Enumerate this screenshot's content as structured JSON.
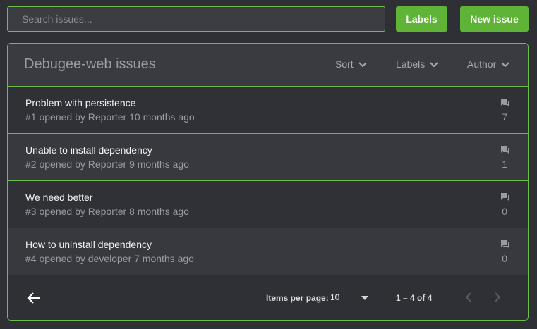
{
  "search": {
    "placeholder": "Search issues..."
  },
  "toolbar": {
    "labels_button": "Labels",
    "new_issue_button": "New issue"
  },
  "panel": {
    "title": "Debugee-web issues",
    "filters": {
      "sort": "Sort",
      "labels": "Labels",
      "author": "Author"
    }
  },
  "issues": [
    {
      "title": "Problem with persistence",
      "meta": "#1 opened by Reporter 10 months ago",
      "comments": "7"
    },
    {
      "title": "Unable to install dependency",
      "meta": "#2 opened by Reporter 9 months ago",
      "comments": "1"
    },
    {
      "title": "We need better",
      "meta": "#3 opened by Reporter 8 months ago",
      "comments": "0"
    },
    {
      "title": "How to uninstall dependency",
      "meta": "#4 opened by developer 7 months ago",
      "comments": "0"
    }
  ],
  "pagination": {
    "items_per_page_label": "Items per page:",
    "items_per_page_value": "10",
    "range": "1 – 4 of 4"
  },
  "icons": {
    "comment": "comment-icon",
    "chevron": "chevron-down-icon",
    "back": "arrow-left-icon",
    "prev": "chevron-left-icon",
    "next": "chevron-right-icon"
  },
  "colors": {
    "accent": "#5fb336",
    "border": "#6abf4b",
    "background": "#2f3035"
  }
}
